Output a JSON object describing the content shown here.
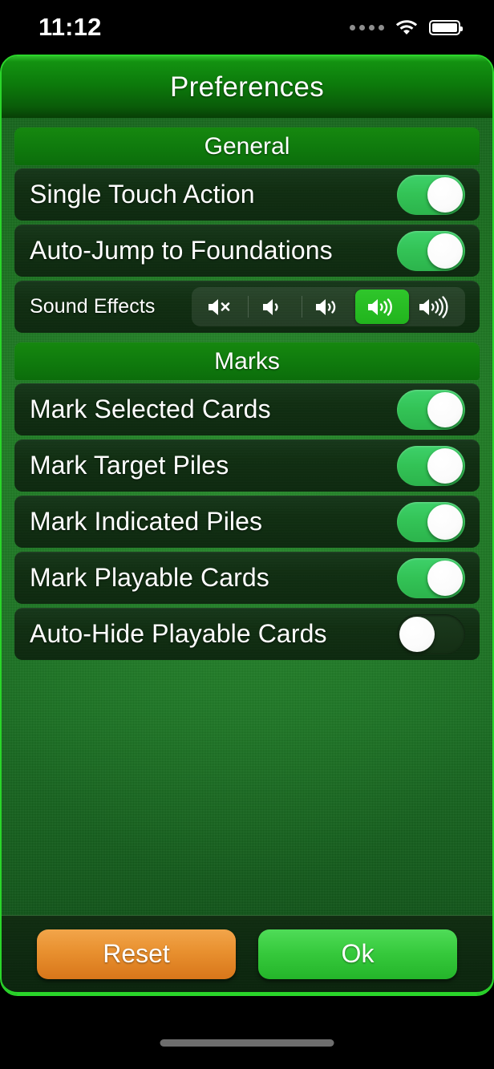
{
  "status_bar": {
    "time": "11:12",
    "signal_icon": "cellular-dots-icon",
    "wifi_icon": "wifi-icon",
    "battery_icon": "battery-full-icon"
  },
  "header": {
    "title": "Preferences"
  },
  "colors": {
    "accent_green": "#2ad62a",
    "header_green": "#0f7a0d",
    "row_dark": "#0f2d10",
    "toggle_on": "#33c356",
    "segment_selected": "#21b41d",
    "reset_orange": "#e8902f",
    "ok_green": "#36c93c"
  },
  "sections": [
    {
      "title": "General",
      "rows": [
        {
          "label": "Single Touch Action",
          "control": "toggle",
          "value": "on"
        },
        {
          "label": "Auto-Jump to Foundations",
          "control": "toggle",
          "value": "on"
        },
        {
          "label": "Sound Effects",
          "control": "segmented",
          "selected_index": 3,
          "options": [
            {
              "icon": "speaker-mute-icon",
              "waves": 0,
              "muted": true
            },
            {
              "icon": "speaker-wave-1-icon",
              "waves": 1,
              "muted": false
            },
            {
              "icon": "speaker-wave-2-icon",
              "waves": 2,
              "muted": false
            },
            {
              "icon": "speaker-wave-3-icon",
              "waves": 3,
              "muted": false
            },
            {
              "icon": "speaker-wave-4-icon",
              "waves": 4,
              "muted": false
            }
          ]
        }
      ]
    },
    {
      "title": "Marks",
      "rows": [
        {
          "label": "Mark Selected Cards",
          "control": "toggle",
          "value": "on"
        },
        {
          "label": "Mark Target Piles",
          "control": "toggle",
          "value": "on"
        },
        {
          "label": "Mark Indicated Piles",
          "control": "toggle",
          "value": "on"
        },
        {
          "label": "Mark Playable Cards",
          "control": "toggle",
          "value": "on"
        },
        {
          "label": "Auto-Hide Playable Cards",
          "control": "toggle",
          "value": "off"
        }
      ]
    }
  ],
  "footer": {
    "reset_label": "Reset",
    "ok_label": "Ok"
  }
}
